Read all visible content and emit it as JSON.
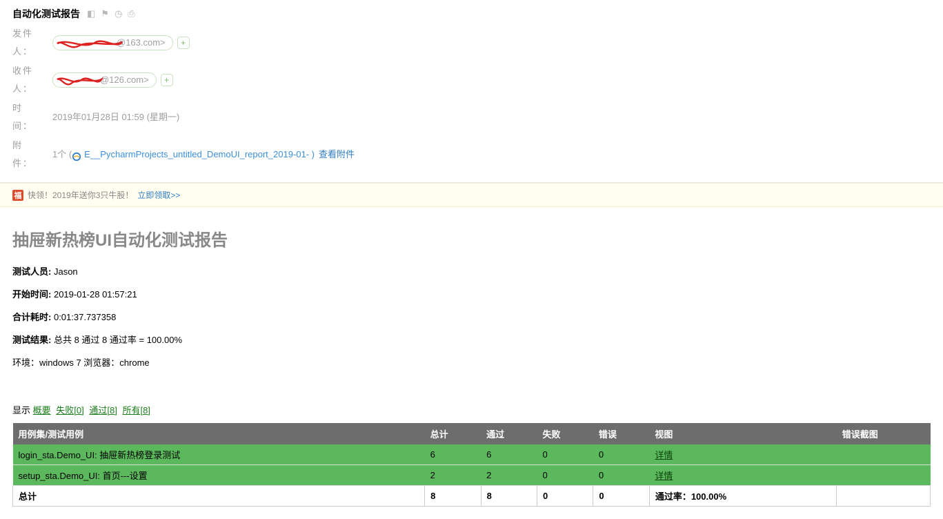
{
  "email": {
    "subject": "自动化测试报告",
    "from_label": "发件人：",
    "from_domain": "@163.com>",
    "to_label": "收件人：",
    "to_domain": "@126.com>",
    "time_label": "时　间：",
    "time_value": "2019年01月28日 01:59 (星期一)",
    "attach_label": "附　件：",
    "attach_count": "1个 (",
    "attach_name": "E__PycharmProjects_untitled_DemoUI_report_2019-01- )",
    "attach_view": "查看附件"
  },
  "promo": {
    "text": "快领！2019年送你3只牛股！",
    "link": "立即领取>>"
  },
  "report": {
    "title": "抽屉新热榜UI自动化测试报告",
    "tester_label": "测试人员:",
    "tester": "Jason",
    "start_label": "开始时间:",
    "start": "2019-01-28 01:57:21",
    "duration_label": "合计耗时:",
    "duration": "0:01:37.737358",
    "result_label": "测试结果:",
    "result": "总共 8 通过 8 通过率 = 100.00%",
    "env": "环境：windows 7 浏览器：chrome"
  },
  "filters": {
    "show": "显示",
    "summary": "概要",
    "fail": "失败[0]",
    "pass": "通过[8]",
    "all": "所有[8]"
  },
  "table": {
    "headers": {
      "case": "用例集/测试用例",
      "total": "总计",
      "pass": "通过",
      "fail": "失败",
      "error": "错误",
      "view": "视图",
      "shot": "错误截图"
    },
    "rows": [
      {
        "name": "login_sta.Demo_UI: 抽屉新热榜登录测试",
        "total": "6",
        "pass": "6",
        "fail": "0",
        "error": "0",
        "view": "详情",
        "shot": ""
      },
      {
        "name": "setup_sta.Demo_UI: 首页---设置",
        "total": "2",
        "pass": "2",
        "fail": "0",
        "error": "0",
        "view": "详情",
        "shot": ""
      }
    ],
    "totals": {
      "label": "总计",
      "total": "8",
      "pass": "8",
      "fail": "0",
      "error": "0",
      "rate": "通过率：100.00%",
      "shot": ""
    }
  }
}
